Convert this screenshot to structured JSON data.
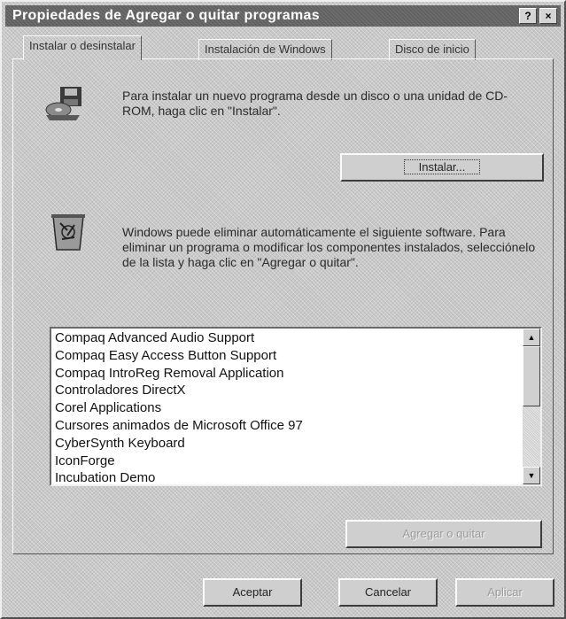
{
  "window": {
    "title": "Propiedades de Agregar o quitar programas",
    "help_glyph": "?",
    "close_glyph": "×"
  },
  "tabs": [
    {
      "label": "Instalar o desinstalar",
      "active": true
    },
    {
      "label": "Instalación de Windows",
      "active": false
    },
    {
      "label": "Disco de inicio",
      "active": false
    }
  ],
  "install_section": {
    "icon": "floppy-cd-install-icon",
    "text": "Para instalar un nuevo programa desde un disco o una unidad de CD-ROM, haga clic en \"Instalar\".",
    "button_label": "Instalar..."
  },
  "remove_section": {
    "icon": "recycle-bin-icon",
    "text": "Windows puede eliminar automáticamente el siguiente software. Para eliminar un programa o modificar los componentes instalados, selecciónelo de la lista y haga clic en \"Agregar o quitar\"."
  },
  "program_list": [
    "Compaq Advanced Audio Support",
    "Compaq Easy Access Button Support",
    "Compaq IntroReg Removal Application",
    "Controladores DirectX",
    "Corel Applications",
    "Cursores animados de Microsoft Office 97",
    "CyberSynth Keyboard",
    "IconForge",
    "Incubation Demo"
  ],
  "add_remove_button": {
    "label": "Agregar o quitar",
    "enabled": false
  },
  "footer_buttons": {
    "ok": "Aceptar",
    "cancel": "Cancelar",
    "apply": "Aplicar"
  },
  "colors": {
    "window_bg": "#c8c8c8",
    "titlebar_bg": "#6c6c6c",
    "disabled_text": "#9a9a9a"
  }
}
